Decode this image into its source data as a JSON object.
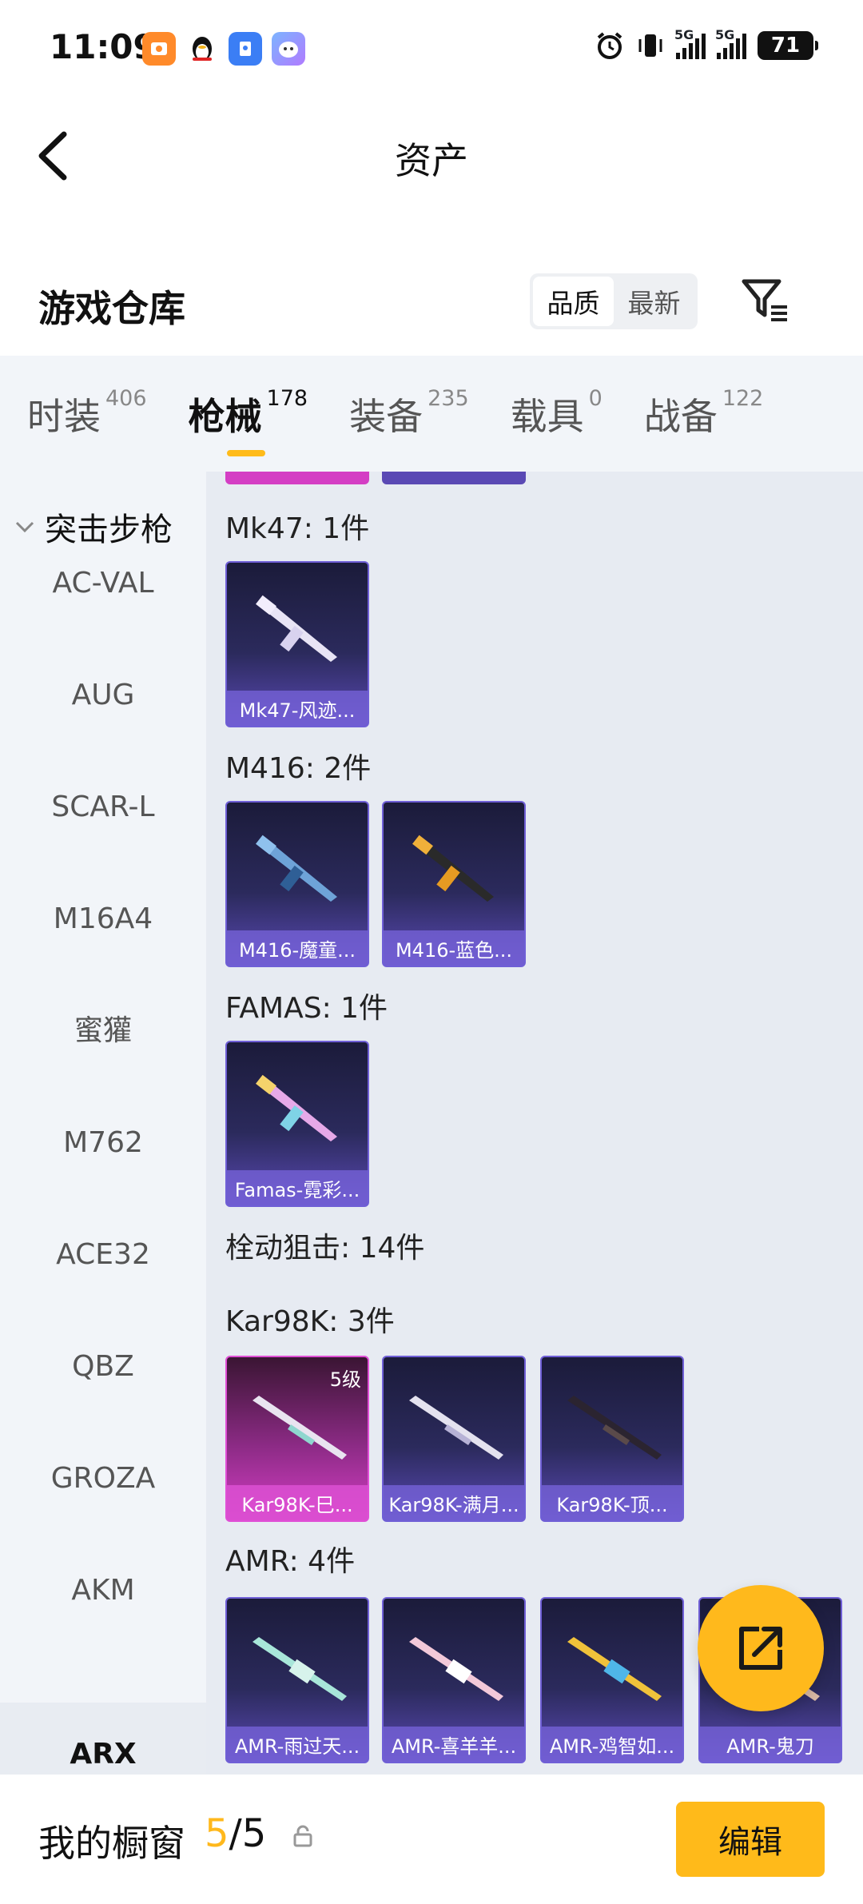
{
  "status_bar": {
    "time": "11:09",
    "network_1": "5G",
    "network_2": "5G",
    "battery": "71"
  },
  "header": {
    "title": "资产"
  },
  "section": {
    "title": "游戏仓库",
    "sort_options": [
      "品质",
      "最新"
    ],
    "sort_selected": "品质"
  },
  "tabs": [
    {
      "label": "时装",
      "count": "406"
    },
    {
      "label": "枪械",
      "count": "178"
    },
    {
      "label": "装备",
      "count": "235"
    },
    {
      "label": "载具",
      "count": "0"
    },
    {
      "label": "战备",
      "count": "122"
    }
  ],
  "active_tab": "枪械",
  "sidebar": {
    "group_label": "突击步枪",
    "items": [
      "AC-VAL",
      "AUG",
      "SCAR-L",
      "M16A4",
      "蜜獾",
      "M762",
      "ACE32",
      "QBZ",
      "GROZA",
      "AKM",
      "ARX"
    ],
    "selected": "ARX"
  },
  "groups": [
    {
      "title": "Mk47: 1件",
      "cards": [
        {
          "name": "Mk47-风迹...",
          "rarity": "purple"
        }
      ]
    },
    {
      "title": "M416: 2件",
      "cards": [
        {
          "name": "M416-魔童...",
          "rarity": "purple"
        },
        {
          "name": "M416-蓝色...",
          "rarity": "purple"
        }
      ]
    },
    {
      "title": "FAMAS: 1件",
      "cards": [
        {
          "name": "Famas-霓彩...",
          "rarity": "purple"
        }
      ]
    },
    {
      "title": "栓动狙击: 14件",
      "cards": []
    },
    {
      "title": "Kar98K: 3件",
      "cards": [
        {
          "name": "Kar98K-巳...",
          "rarity": "pink",
          "level": "5级"
        },
        {
          "name": "Kar98K-满月...",
          "rarity": "purple"
        },
        {
          "name": "Kar98K-顶...",
          "rarity": "purple"
        }
      ]
    },
    {
      "title": "AMR: 4件",
      "cards": [
        {
          "name": "AMR-雨过天...",
          "rarity": "purple"
        },
        {
          "name": "AMR-喜羊羊...",
          "rarity": "purple"
        },
        {
          "name": "AMR-鸡智如...",
          "rarity": "purple"
        },
        {
          "name": "AMR-鬼刀",
          "rarity": "purple"
        }
      ]
    }
  ],
  "bottom_bar": {
    "title": "我的橱窗",
    "count_current": "5",
    "count_separator": "/",
    "count_total": "5",
    "edit_label": "编辑"
  },
  "colors": {
    "accent": "#ffb81c",
    "card_purple": "#5a49b4",
    "card_pink": "#d43ec4",
    "panel_bg": "#e7ebf2",
    "sidebar_bg": "#f2f5f9"
  }
}
